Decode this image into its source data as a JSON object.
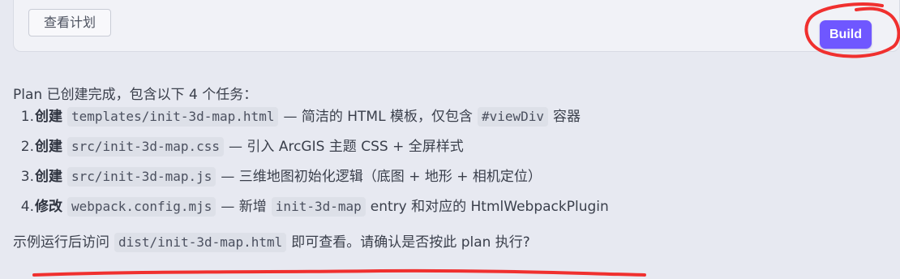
{
  "top_card": {
    "view_plan_label": "查看计划",
    "build_label": "Build"
  },
  "message": {
    "intro": "Plan 已创建完成，包含以下 4 个任务：",
    "tasks": [
      {
        "num": "1.",
        "verb": "创建",
        "code": "templates/init-3d-map.html",
        "desc_before": "— 简洁的 HTML 模板，仅包含",
        "code2": "#viewDiv",
        "desc_after": "容器"
      },
      {
        "num": "2.",
        "verb": "创建",
        "code": "src/init-3d-map.css",
        "desc_before": "— 引入 ArcGIS 主题 CSS + 全屏样式"
      },
      {
        "num": "3.",
        "verb": "创建",
        "code": "src/init-3d-map.js",
        "desc_before": "— 三维地图初始化逻辑（底图 + 地形 + 相机定位）"
      },
      {
        "num": "4.",
        "verb": "修改",
        "code": "webpack.config.mjs",
        "desc_before": "— 新增",
        "code2": "init-3d-map",
        "desc_after": "entry 和对应的 HtmlWebpackPlugin"
      }
    ],
    "footer_before": "示例运行后访问",
    "footer_code": "dist/init-3d-map.html",
    "footer_after": "即可查看。请确认是否按此 plan 执行?"
  },
  "colors": {
    "page_bg": "#e7e9f1",
    "card_bg": "#f1f2f7",
    "accent": "#6f57ff",
    "annotation": "#f0302f"
  }
}
